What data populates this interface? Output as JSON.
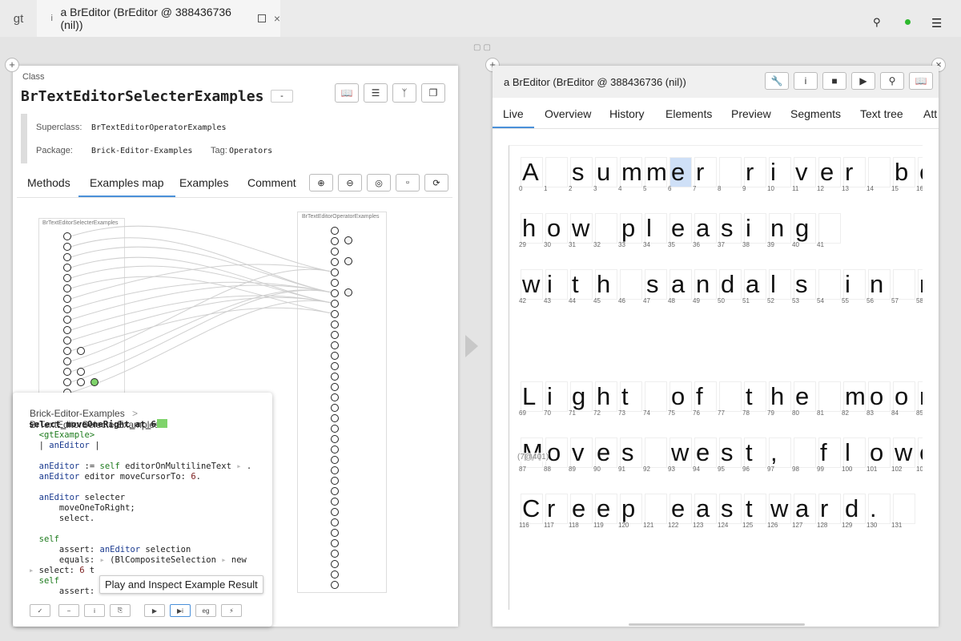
{
  "topbar": {
    "logo": "gt",
    "tab_title": "a BrEditor (BrEditor @ 388436736 (nil))"
  },
  "left": {
    "class_label": "Class",
    "class_name": "BrTextEditorSelecterExamples",
    "minus": "-",
    "superclass_label": "Superclass:",
    "superclass": "BrTextEditorOperatorExamples",
    "package_label": "Package:",
    "package": "Brick-Editor-Examples",
    "tag_label": "Tag:",
    "tag": "Operators",
    "tabs": [
      "Methods",
      "Examples map",
      "Examples",
      "Comment"
    ],
    "map_left_title": "BrTextEditorSelecterExamples",
    "map_right_title": "BrTextEditorOperatorExamples"
  },
  "popup": {
    "crumb1": "Brick-Editor-Examples",
    "crumb_sep": ">",
    "crumb2": "BrTextEditorSelecterExamples",
    "method": "select_moveOneRight_at_6",
    "code": [
      "  <gtExample>",
      "  | anEditor |",
      "",
      "  anEditor := self editorOnMultilineText ▸ .",
      "  anEditor editor moveCursorTo: 6.",
      "",
      "  anEditor selecter",
      "      moveOneToRight;",
      "      select.",
      "",
      "  self",
      "      assert: anEditor selection",
      "      equals: ▸ (BlCompositeSelection ▸ new",
      "▸ select: 6 t",
      "  self",
      "      assert: anEditor"
    ],
    "tooltip": "Play and Inspect Example Result",
    "buttons": [
      "✓",
      "−",
      "i",
      "⎘",
      "▶",
      "▶i",
      "eg",
      "⚡"
    ]
  },
  "right": {
    "title": "a BrEditor (BrEditor @ 388436736 (nil))",
    "tabs": [
      "Live",
      "Overview",
      "History",
      "Elements",
      "Preview",
      "Segments",
      "Text tree",
      "Att"
    ],
    "tooltip_pos": "(7@401)",
    "lines": [
      {
        "chars": [
          [
            "A",
            "0"
          ],
          [
            " ",
            "1"
          ],
          [
            "s",
            "2"
          ],
          [
            "u",
            "3"
          ],
          [
            "m",
            "4"
          ],
          [
            "m",
            "5"
          ],
          [
            "e",
            "6"
          ],
          [
            "r",
            "7"
          ],
          [
            " ",
            "8"
          ],
          [
            "r",
            "9"
          ],
          [
            "i",
            "10"
          ],
          [
            "v",
            "11"
          ],
          [
            "e",
            "12"
          ],
          [
            "r",
            "13"
          ],
          [
            " ",
            "14"
          ],
          [
            "b",
            "15"
          ],
          [
            "e",
            "16"
          ]
        ]
      },
      {
        "chars": [
          [
            "h",
            "29"
          ],
          [
            "o",
            "30"
          ],
          [
            "w",
            "31"
          ],
          [
            " ",
            "32"
          ],
          [
            "p",
            "33"
          ],
          [
            "l",
            "34"
          ],
          [
            "e",
            "35"
          ],
          [
            "a",
            "36"
          ],
          [
            "s",
            "37"
          ],
          [
            "i",
            "38"
          ],
          [
            "n",
            "39"
          ],
          [
            "g",
            "40"
          ],
          [
            " ",
            "41"
          ]
        ]
      },
      {
        "chars": [
          [
            "w",
            "42"
          ],
          [
            "i",
            "43"
          ],
          [
            "t",
            "44"
          ],
          [
            "h",
            "45"
          ],
          [
            " ",
            "46"
          ],
          [
            "s",
            "47"
          ],
          [
            "a",
            "48"
          ],
          [
            "n",
            "49"
          ],
          [
            "d",
            "50"
          ],
          [
            "a",
            "51"
          ],
          [
            "l",
            "52"
          ],
          [
            "s",
            "53"
          ],
          [
            " ",
            "54"
          ],
          [
            "i",
            "55"
          ],
          [
            "n",
            "56"
          ],
          [
            " ",
            "57"
          ],
          [
            "m",
            "58"
          ]
        ]
      },
      {
        "chars": [
          [
            "L",
            "69"
          ],
          [
            "i",
            "70"
          ],
          [
            "g",
            "71"
          ],
          [
            "h",
            "72"
          ],
          [
            "t",
            "73"
          ],
          [
            " ",
            "74"
          ],
          [
            "o",
            "75"
          ],
          [
            "f",
            "76"
          ],
          [
            " ",
            "77"
          ],
          [
            "t",
            "78"
          ],
          [
            "h",
            "79"
          ],
          [
            "e",
            "80"
          ],
          [
            " ",
            "81"
          ],
          [
            "m",
            "82"
          ],
          [
            "o",
            "83"
          ],
          [
            "o",
            "84"
          ],
          [
            "n",
            "85"
          ]
        ]
      },
      {
        "chars": [
          [
            "M",
            "87"
          ],
          [
            "o",
            "88"
          ],
          [
            "v",
            "89"
          ],
          [
            "e",
            "90"
          ],
          [
            "s",
            "91"
          ],
          [
            " ",
            "92"
          ],
          [
            "w",
            "93"
          ],
          [
            "e",
            "94"
          ],
          [
            "s",
            "95"
          ],
          [
            "t",
            "96"
          ],
          [
            ",",
            "97"
          ],
          [
            " ",
            "98"
          ],
          [
            "f",
            "99"
          ],
          [
            "l",
            "100"
          ],
          [
            "o",
            "101"
          ],
          [
            "w",
            "102"
          ],
          [
            "e",
            "103"
          ]
        ]
      },
      {
        "chars": [
          [
            "C",
            "116"
          ],
          [
            "r",
            "117"
          ],
          [
            "e",
            "118"
          ],
          [
            "e",
            "119"
          ],
          [
            "p",
            "120"
          ],
          [
            " ",
            "121"
          ],
          [
            "e",
            "122"
          ],
          [
            "a",
            "123"
          ],
          [
            "s",
            "124"
          ],
          [
            "t",
            "125"
          ],
          [
            "w",
            "126"
          ],
          [
            "a",
            "127"
          ],
          [
            "r",
            "128"
          ],
          [
            "d",
            "129"
          ],
          [
            ".",
            "130"
          ],
          [
            " ",
            "131"
          ]
        ]
      }
    ]
  }
}
